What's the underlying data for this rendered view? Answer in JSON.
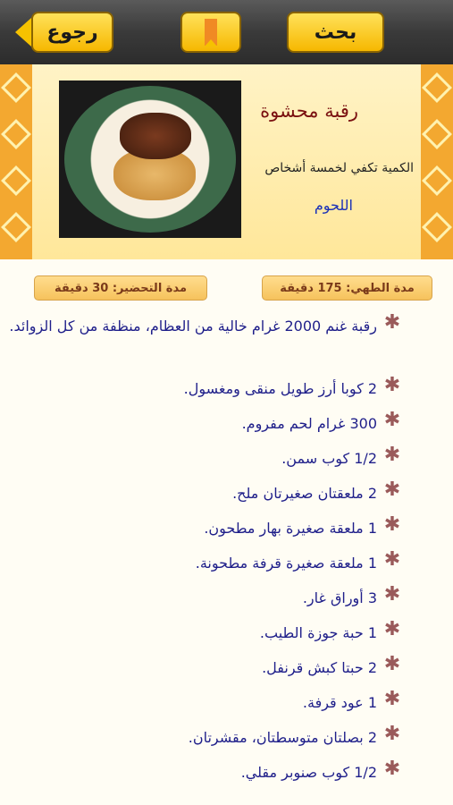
{
  "toolbar": {
    "search_label": "بحث",
    "back_label": "رجوع"
  },
  "recipe": {
    "title": "رقبة محشوة",
    "serving": "الكمية تكفي لخمسة أشخاص",
    "category": "اللحوم",
    "cook_time_label": "مدة الطهي:",
    "cook_time_value": "175 دقيقة",
    "prep_time_label": "مدة التحضير:",
    "prep_time_value": "30 دقيقة"
  },
  "ingredients": [
    "رقبة غنم 2000 غرام خالية من العظام، منظفة من كل الزوائد.",
    "2 كوبا أرز طويل منقى ومغسول.",
    "300 غرام لحم مفروم.",
    "1/2 كوب سمن.",
    "2 ملعقتان صغيرتان ملح.",
    "1 ملعقة صغيرة بهار مطحون.",
    "1 ملعقة صغيرة قرفة مطحونة.",
    "3 أوراق غار.",
    "1 حبة جوزة الطيب.",
    "2 حبتا كبش قرنفل.",
    "1 عود قرفة.",
    "2 بصلتان متوسطتان، مقشرتان.",
    "1/2 كوب صنوبر مقلي."
  ]
}
